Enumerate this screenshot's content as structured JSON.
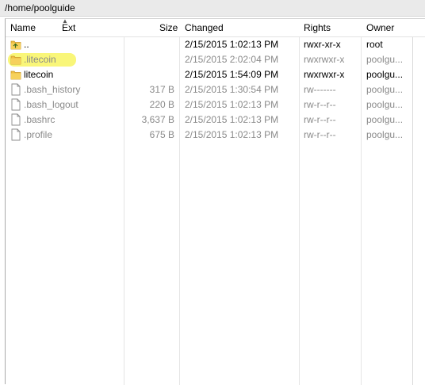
{
  "path": "/home/poolguide",
  "columns": {
    "name": "Name",
    "ext": "Ext",
    "size": "Size",
    "changed": "Changed",
    "rights": "Rights",
    "owner": "Owner"
  },
  "rows": [
    {
      "icon": "parent-folder-icon",
      "name": "..",
      "size": "",
      "changed": "2/15/2015 1:02:13 PM",
      "rights": "rwxr-xr-x",
      "owner": "root",
      "hidden": false
    },
    {
      "icon": "folder-icon",
      "name": ".litecoin",
      "size": "",
      "changed": "2/15/2015 2:02:04 PM",
      "rights": "rwxrwxr-x",
      "owner": "poolgu...",
      "hidden": true
    },
    {
      "icon": "folder-icon",
      "name": "litecoin",
      "size": "",
      "changed": "2/15/2015 1:54:09 PM",
      "rights": "rwxrwxr-x",
      "owner": "poolgu...",
      "hidden": false
    },
    {
      "icon": "file-icon",
      "name": ".bash_history",
      "size": "317 B",
      "changed": "2/15/2015 1:30:54 PM",
      "rights": "rw-------",
      "owner": "poolgu...",
      "hidden": true
    },
    {
      "icon": "file-icon",
      "name": ".bash_logout",
      "size": "220 B",
      "changed": "2/15/2015 1:02:13 PM",
      "rights": "rw-r--r--",
      "owner": "poolgu...",
      "hidden": true
    },
    {
      "icon": "file-icon",
      "name": ".bashrc",
      "size": "3,637 B",
      "changed": "2/15/2015 1:02:13 PM",
      "rights": "rw-r--r--",
      "owner": "poolgu...",
      "hidden": true
    },
    {
      "icon": "file-icon",
      "name": ".profile",
      "size": "675 B",
      "changed": "2/15/2015 1:02:13 PM",
      "rights": "rw-r--r--",
      "owner": "poolgu...",
      "hidden": true
    }
  ],
  "colors": {
    "highlight": "#f8f56a",
    "folder": "#e8b52a",
    "hidden_text": "#8a8a8a"
  }
}
